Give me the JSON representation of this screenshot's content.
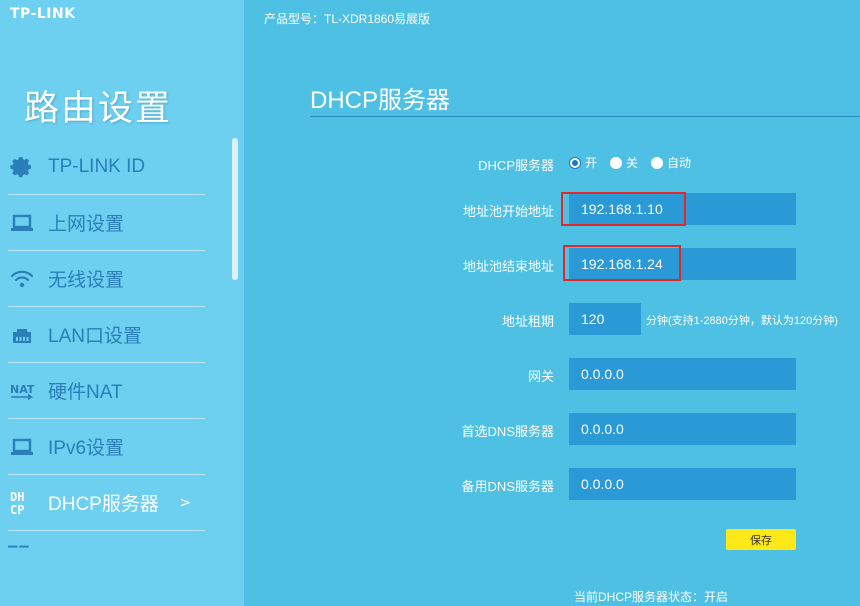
{
  "brand": {
    "logo": "TP-LINK"
  },
  "sidebar": {
    "title": "路由设置",
    "items": [
      {
        "label": "TP-LINK ID",
        "icon": "gear-icon"
      },
      {
        "label": "上网设置",
        "icon": "laptop-icon"
      },
      {
        "label": "无线设置",
        "icon": "wifi-icon"
      },
      {
        "label": "LAN口设置",
        "icon": "lan-port-icon"
      },
      {
        "label": "硬件NAT",
        "icon": "nat-icon",
        "icon_text": "NAT"
      },
      {
        "label": "IPv6设置",
        "icon": "laptop-icon"
      },
      {
        "label": "DHCP服务器",
        "icon": "dhcp-icon",
        "icon_text_1": "DH",
        "icon_text_2": "CP",
        "arrow": ">"
      }
    ]
  },
  "header": {
    "model": "产品型号：TL-XDR1860易展版"
  },
  "main": {
    "title": "DHCP服务器",
    "dhcp_server": {
      "label": "DHCP服务器",
      "options": [
        "开",
        "关",
        "自动"
      ],
      "selected": "开"
    },
    "pool_start": {
      "label": "地址池开始地址",
      "value": "192.168.1.10"
    },
    "pool_end": {
      "label": "地址池结束地址",
      "value": "192.168.1.24"
    },
    "lease": {
      "label": "地址租期",
      "value": "120",
      "hint": "分钟(支持1-2880分钟，默认为120分钟)"
    },
    "gateway": {
      "label": "网关",
      "value": "0.0.0.0"
    },
    "primary_dns": {
      "label": "首选DNS服务器",
      "value": "0.0.0.0"
    },
    "secondary_dns": {
      "label": "备用DNS服务器",
      "value": "0.0.0.0"
    },
    "save_label": "保存",
    "status": "当前DHCP服务器状态：开启"
  },
  "colors": {
    "background": "#4ec0e4",
    "sidebar": "#6dd0f0",
    "field": "#2a9ad6",
    "highlight": "#e02828",
    "save_button": "#ffe818"
  }
}
